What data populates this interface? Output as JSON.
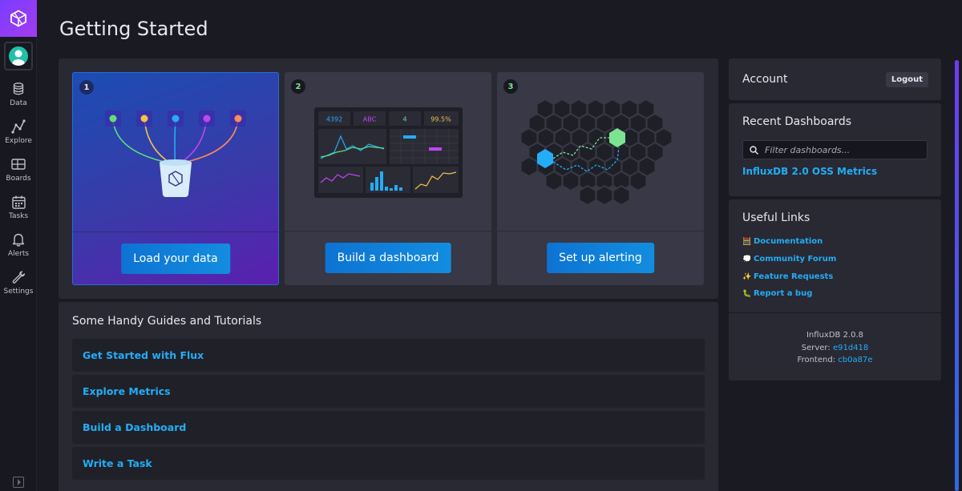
{
  "page_title": "Getting Started",
  "sidebar": {
    "items": [
      {
        "label": "Data",
        "icon": "database-icon"
      },
      {
        "label": "Explore",
        "icon": "graph-line-icon"
      },
      {
        "label": "Boards",
        "icon": "dashboards-icon"
      },
      {
        "label": "Tasks",
        "icon": "calendar-icon"
      },
      {
        "label": "Alerts",
        "icon": "bell-icon"
      },
      {
        "label": "Settings",
        "icon": "wrench-icon"
      }
    ]
  },
  "steps": [
    {
      "number": "1",
      "button": "Load your data"
    },
    {
      "number": "2",
      "button": "Build a dashboard"
    },
    {
      "number": "3",
      "button": "Set up alerting"
    }
  ],
  "dashboard_preview": {
    "cells": [
      "4392",
      "ABC",
      "4",
      "99.5%"
    ]
  },
  "guides": {
    "title": "Some Handy Guides and Tutorials",
    "items": [
      "Get Started with Flux",
      "Explore Metrics",
      "Build a Dashboard",
      "Write a Task"
    ]
  },
  "account": {
    "title": "Account",
    "logout": "Logout"
  },
  "recent_dashboards": {
    "title": "Recent Dashboards",
    "filter_placeholder": "Filter dashboards...",
    "items": [
      "InfluxDB 2.0 OSS Metrics"
    ]
  },
  "useful_links": {
    "title": "Useful Links",
    "items": [
      {
        "emoji": "🧮",
        "label": "Documentation"
      },
      {
        "emoji": "💭",
        "label": "Community Forum"
      },
      {
        "emoji": "✨",
        "label": "Feature Requests"
      },
      {
        "emoji": "🐛",
        "label": "Report a bug"
      }
    ]
  },
  "version": {
    "product": "InfluxDB 2.0.8",
    "server_label": "Server:",
    "server": "e91d418",
    "frontend_label": "Frontend:",
    "frontend": "cb0a87e"
  },
  "colors": {
    "accent": "#22adf6",
    "button": "#0e7ad8",
    "brand": "#9b3cf0"
  }
}
